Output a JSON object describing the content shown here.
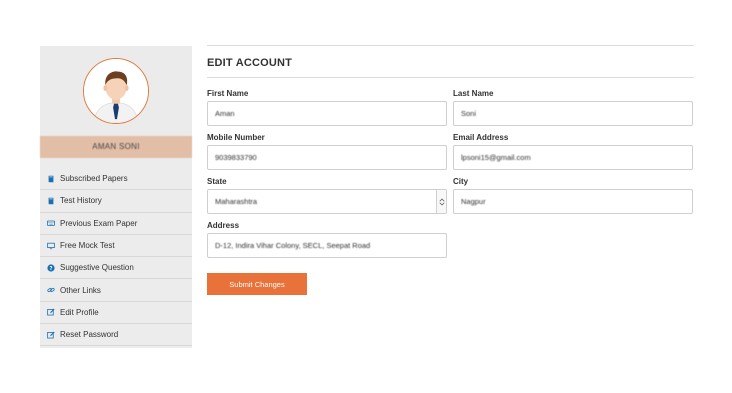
{
  "sidebar": {
    "user_name": "AMAN SONI",
    "items": [
      {
        "label": "Subscribed Papers",
        "icon": "book-icon"
      },
      {
        "label": "Test History",
        "icon": "book-icon"
      },
      {
        "label": "Previous Exam Paper",
        "icon": "keyboard-icon"
      },
      {
        "label": "Free Mock Test",
        "icon": "monitor-icon"
      },
      {
        "label": "Suggestive Question",
        "icon": "question-circle-icon"
      },
      {
        "label": "Other Links",
        "icon": "link-icon"
      },
      {
        "label": "Edit Profile",
        "icon": "edit-icon"
      },
      {
        "label": "Reset Password",
        "icon": "edit-icon"
      }
    ]
  },
  "main": {
    "title": "EDIT ACCOUNT",
    "fields": {
      "first_name": {
        "label": "First Name",
        "value": "Aman"
      },
      "last_name": {
        "label": "Last Name",
        "value": "Soni"
      },
      "mobile": {
        "label": "Mobile Number",
        "value": "9039833790"
      },
      "email": {
        "label": "Email Address",
        "value": "lpsoni15@gmail.com"
      },
      "state": {
        "label": "State",
        "value": "Maharashtra"
      },
      "city": {
        "label": "City",
        "value": "Nagpur"
      },
      "address": {
        "label": "Address",
        "value": "D-12, Indira Vihar Colony, SECL, Seepat Road"
      }
    },
    "submit_label": "Submit Changes"
  },
  "colors": {
    "accent": "#e8723a",
    "name_bar": "#e2bea7",
    "sidebar_bg": "#ececec",
    "icon_blue": "#1b6fb3"
  }
}
